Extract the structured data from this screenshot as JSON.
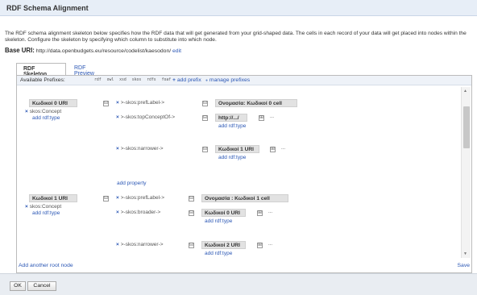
{
  "dialog": {
    "title": "RDF Schema Alignment",
    "intro": "The RDF schema alignment skeleton below specifies how the RDF data that will get generated from your grid-shaped data. The cells in each record of your data will get placed into nodes within the skeleton. Configure the skeleton by specifying which column to substitute into which node.",
    "base_uri_label": "Base URI:",
    "base_uri_value": "http://data.openbudgets.eu/resource/codelist/kaesodon/",
    "base_uri_edit": "edit"
  },
  "tabs": [
    {
      "label": "RDF Skeleton",
      "active": true
    },
    {
      "label": "RDF Preview",
      "active": false
    }
  ],
  "prefix_bar": {
    "label": "Available Prefixes:",
    "prefixes": [
      "rdf",
      "owl",
      "xsd",
      "skos",
      "rdfs",
      "foaf"
    ],
    "add_prefix": "add prefix",
    "manage_prefixes": "manage prefixes"
  },
  "skeleton": {
    "root_nodes": [
      {
        "title": "Κωδικοί 0 URI",
        "type_label": "skos:Concept",
        "add_type": "add rdf:type",
        "properties": [
          {
            "label": ">-skos:prefLabel->",
            "target": "Ονομασία: Κωδικοί 0 cell"
          },
          {
            "label": ">-skos:topConceptOf->",
            "target": "http://.../",
            "add_type": "add rdf:type",
            "ellipsis": "..."
          },
          {
            "label": ">-skos:narrower->",
            "target": "Κωδικοί 1 URI",
            "add_type": "add rdf:type",
            "ellipsis": "..."
          }
        ],
        "add_property": "add property"
      },
      {
        "title": "Κωδικοί 1 URI",
        "type_label": "skos:Concept",
        "add_type": "add rdf:type",
        "properties": [
          {
            "label": ">-skos:prefLabel->",
            "target": "Ονομασία : Κωδικοί 1 cell"
          },
          {
            "label": ">-skos:broader->",
            "target": "Κωδικοί 0 URI",
            "add_type": "add rdf:type",
            "ellipsis": "..."
          },
          {
            "label": ">-skos:narrower->",
            "target": "Κωδικοί 2 URI",
            "add_type": "add rdf:type",
            "ellipsis": "..."
          }
        ]
      }
    ],
    "add_root_node": "Add another root node",
    "save": "Save"
  },
  "buttons": {
    "ok": "OK",
    "cancel": "Cancel"
  },
  "icons": {
    "remove": "×",
    "collapse": "⊟",
    "expand": "⊞",
    "plus": "+",
    "manage": "●",
    "scroll_up": "▲",
    "scroll_down": "▼"
  },
  "colors": {
    "header_bg": "#e7eef7",
    "link": "#2b57b5",
    "node_bg": "#e2e2e2",
    "footer_bg": "#e9edf2"
  }
}
